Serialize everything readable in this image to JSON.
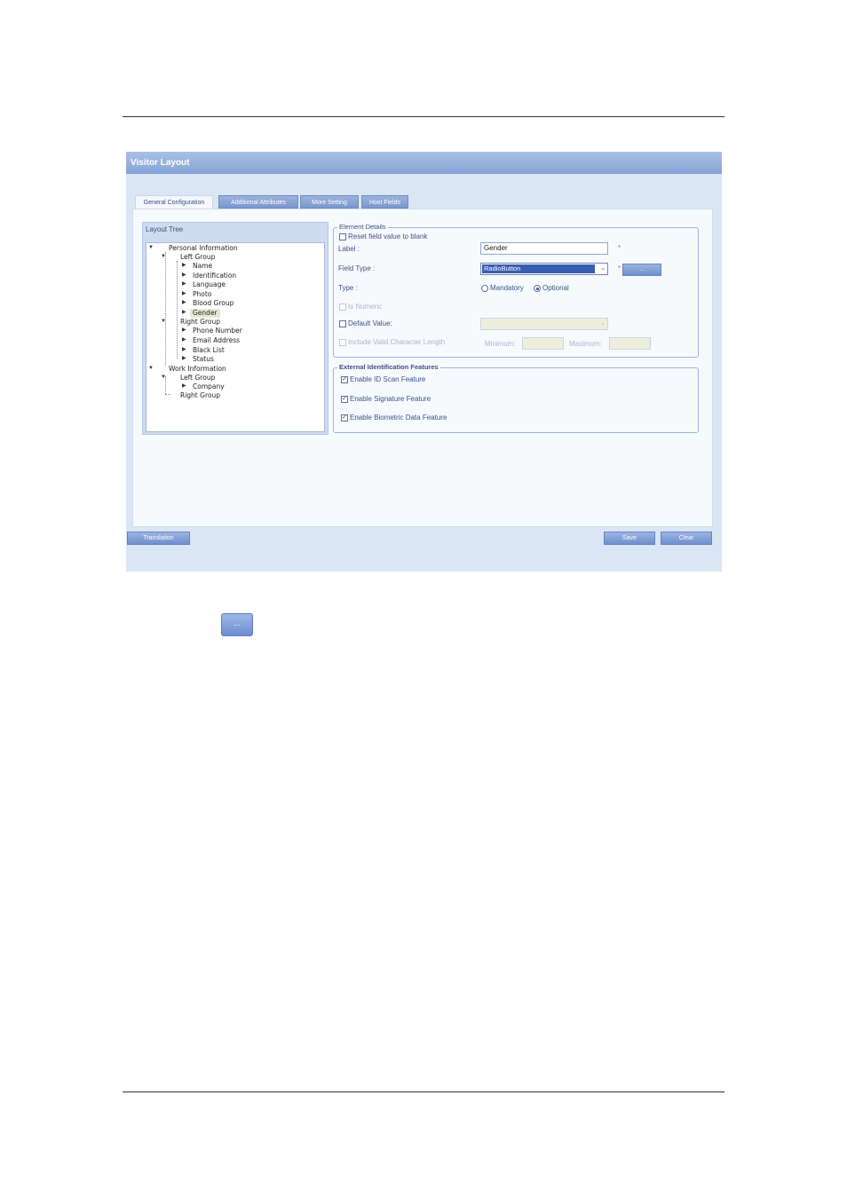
{
  "window": {
    "title": "Visitor Layout"
  },
  "tabs": [
    "General Configuration",
    "Additional Attributes",
    "More Setting",
    "Host Fields"
  ],
  "tree": {
    "header": "Layout Tree",
    "personal": "Personal Information",
    "left_group": "Left Group",
    "left_items": [
      "Name",
      "Identification",
      "Language",
      "Photo",
      "Blood Group",
      "Gender"
    ],
    "right_group": "Right Group",
    "right_items": [
      "Phone Number",
      "Email Address",
      "Black List",
      "Status"
    ],
    "work": "Work Information",
    "work_left": "Left Group",
    "work_left_items": [
      "Company"
    ],
    "work_right": "Right Group"
  },
  "element_details": {
    "legend": "Element Details",
    "reset_label": "Reset field value to blank",
    "reset_checked": false,
    "label_label": "Label :",
    "label_value": "Gender",
    "field_type_label": "Field Type :",
    "field_type_value": "RadioButton",
    "field_type_button": "...",
    "required_mark": "*",
    "type_label": "Type :",
    "type_options": [
      "Mandatory",
      "Optional"
    ],
    "type_selected": "Optional",
    "is_numeric_label": "Is Numeric",
    "default_value_label": "Default Value:",
    "valid_length_label": "Include Valid Character Length",
    "minimum_label": "Minimum:",
    "maximum_label": "Maximum:"
  },
  "external_features": {
    "legend": "External Identification Features",
    "items": [
      {
        "label": "Enable ID Scan Feature",
        "checked": true
      },
      {
        "label": "Enable Signature Feature",
        "checked": true
      },
      {
        "label": "Enable Biometric Data Feature",
        "checked": true
      }
    ]
  },
  "footer": {
    "translation": "Translation",
    "save": "Save",
    "clear": "Clear"
  },
  "standalone_button": "...",
  "check_glyph": "✓",
  "colors": {
    "title_bar": "#86a3d6",
    "panel_bg": "#dbe6f5",
    "required": "#e05a4a"
  }
}
